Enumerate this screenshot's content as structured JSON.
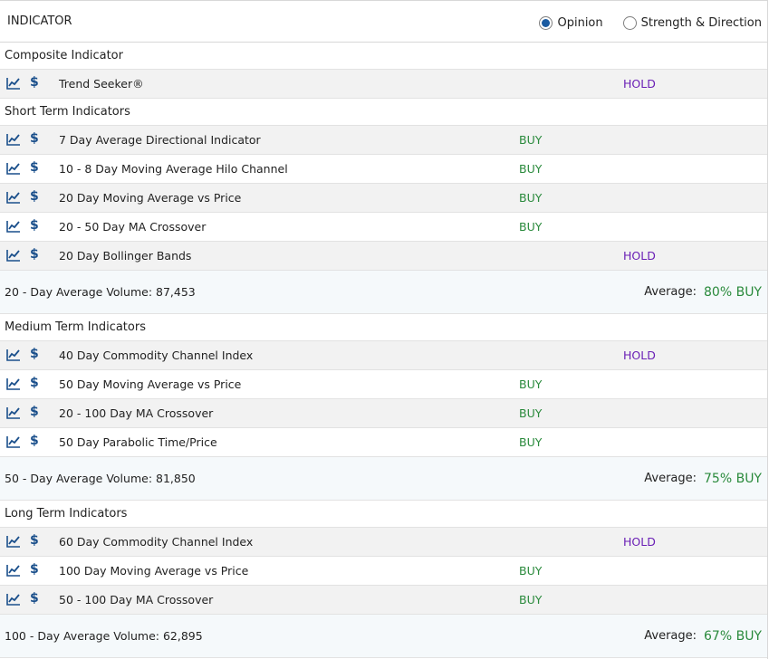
{
  "header": {
    "title": "INDICATOR",
    "radio_opinion": "Opinion",
    "radio_strength": "Strength & Direction",
    "selected": "Opinion"
  },
  "colors": {
    "buy": "#2a8a3c",
    "hold": "#6a1fb5",
    "icon": "#1a4f8b"
  },
  "icons": {
    "chart": "line-chart-icon",
    "dollar": "dollar-icon"
  },
  "composite": {
    "title": "Composite Indicator",
    "rows": [
      {
        "name": "Trend Seeker®",
        "buy": "",
        "hold": "HOLD"
      }
    ]
  },
  "short_term": {
    "title": "Short Term Indicators",
    "rows": [
      {
        "name": "7 Day Average Directional Indicator",
        "buy": "BUY",
        "hold": ""
      },
      {
        "name": "10 - 8 Day Moving Average Hilo Channel",
        "buy": "BUY",
        "hold": ""
      },
      {
        "name": "20 Day Moving Average vs Price",
        "buy": "BUY",
        "hold": ""
      },
      {
        "name": "20 - 50 Day MA Crossover",
        "buy": "BUY",
        "hold": ""
      },
      {
        "name": "20 Day Bollinger Bands",
        "buy": "",
        "hold": "HOLD"
      }
    ],
    "volume": "20 - Day Average Volume: 87,453",
    "average_label": "Average:",
    "average_value": "80% BUY"
  },
  "medium_term": {
    "title": "Medium Term Indicators",
    "rows": [
      {
        "name": "40 Day Commodity Channel Index",
        "buy": "",
        "hold": "HOLD"
      },
      {
        "name": "50 Day Moving Average vs Price",
        "buy": "BUY",
        "hold": ""
      },
      {
        "name": "20 - 100 Day MA Crossover",
        "buy": "BUY",
        "hold": ""
      },
      {
        "name": "50 Day Parabolic Time/Price",
        "buy": "BUY",
        "hold": ""
      }
    ],
    "volume": "50 - Day Average Volume: 81,850",
    "average_label": "Average:",
    "average_value": "75% BUY"
  },
  "long_term": {
    "title": "Long Term Indicators",
    "rows": [
      {
        "name": "60 Day Commodity Channel Index",
        "buy": "",
        "hold": "HOLD"
      },
      {
        "name": "100 Day Moving Average vs Price",
        "buy": "BUY",
        "hold": ""
      },
      {
        "name": "50 - 100 Day MA Crossover",
        "buy": "BUY",
        "hold": ""
      }
    ],
    "volume": "100 - Day Average Volume: 62,895",
    "average_label": "Average:",
    "average_value": "67% BUY"
  }
}
